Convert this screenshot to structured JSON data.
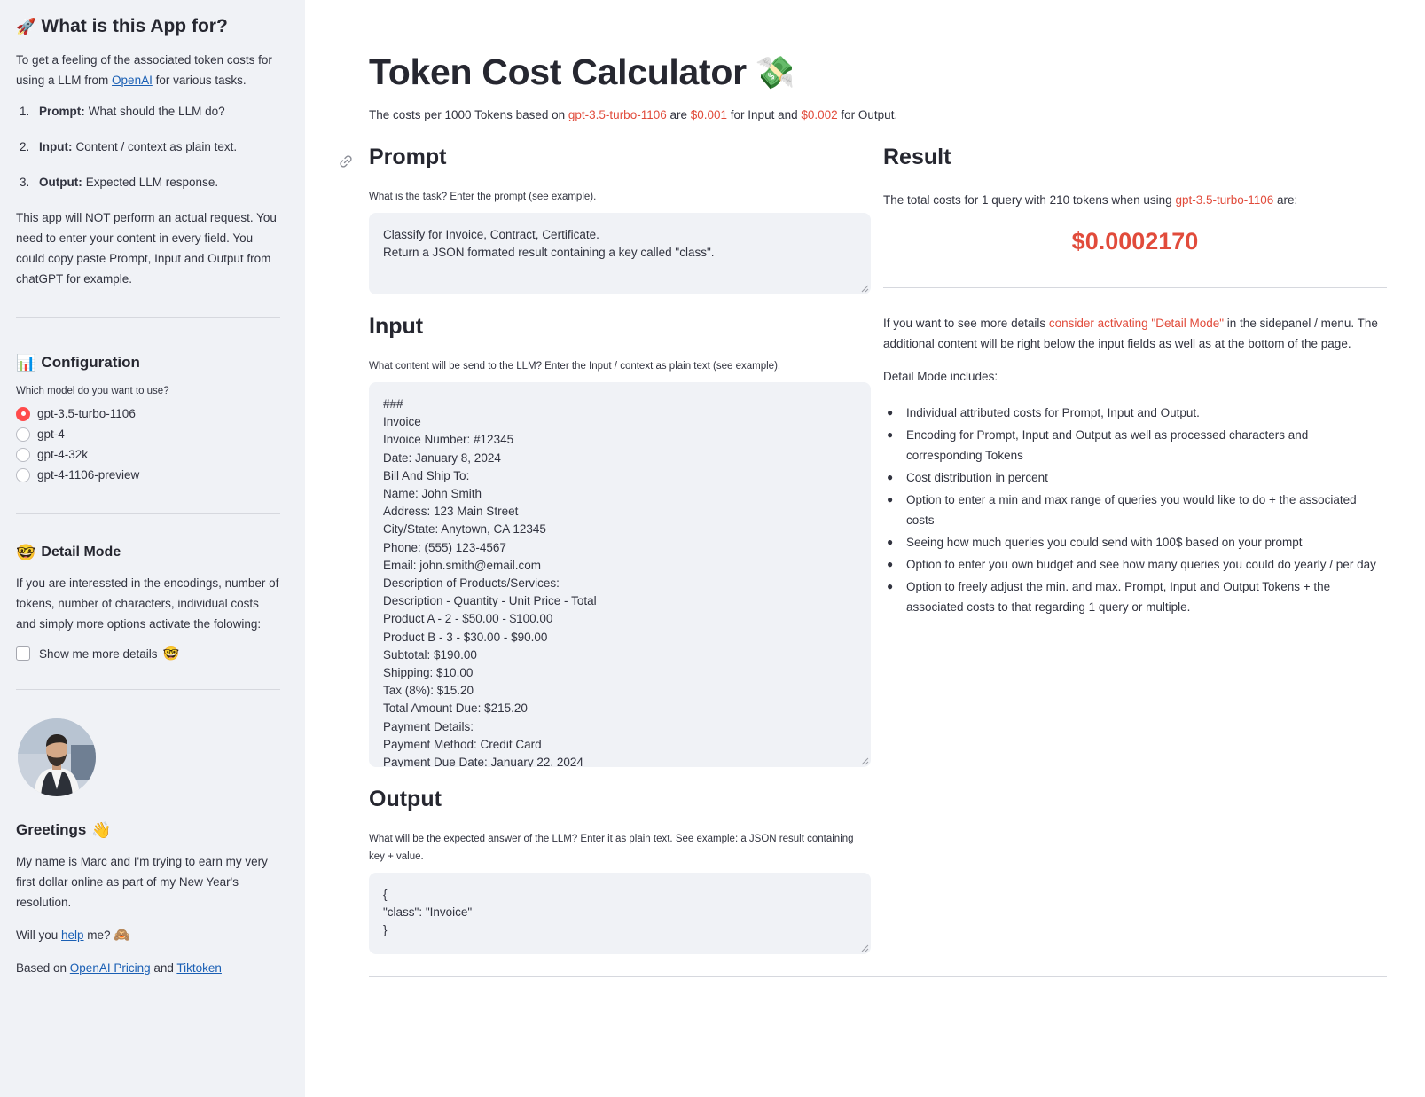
{
  "sidebar": {
    "about": {
      "heading": "What is this App for?",
      "intro_pre": "To get a feeling of the associated token costs for using a LLM from ",
      "intro_link": "OpenAI",
      "intro_post": " for various tasks.",
      "steps": [
        {
          "num": "1.",
          "label": "Prompt:",
          "text": "What should the LLM do?"
        },
        {
          "num": "2.",
          "label": "Input:",
          "text": "Content / context as plain text."
        },
        {
          "num": "3.",
          "label": "Output:",
          "text": "Expected LLM response."
        }
      ],
      "note": "This app will NOT perform an actual request. You need to enter your content in every field. You could copy paste Prompt, Input and Output from chatGPT for example."
    },
    "config": {
      "heading": "Configuration",
      "question": "Which model do you want to use?",
      "models": [
        "gpt-3.5-turbo-1106",
        "gpt-4",
        "gpt-4-32k",
        "gpt-4-1106-preview"
      ],
      "selected": "gpt-3.5-turbo-1106"
    },
    "detail": {
      "heading": "Detail Mode",
      "text": "If you are interessted in the encodings, number of tokens, number of characters, individual costs and simply more options activate the folowing:",
      "checkbox_label": "Show me more details",
      "checked": false
    },
    "greetings": {
      "heading": "Greetings",
      "text": "My name is Marc and I'm trying to earn my very first dollar online as part of my New Year's resolution.",
      "help_pre": "Will you ",
      "help_link": "help",
      "help_post": " me?",
      "based_pre": "Based on ",
      "based_link1": "OpenAI Pricing",
      "based_mid": " and ",
      "based_link2": "Tiktoken"
    }
  },
  "main": {
    "title": "Token Cost Calculator",
    "subtitle": {
      "pre": "The costs per 1000 Tokens based on ",
      "model": "gpt-3.5-turbo-1106",
      "mid1": " are ",
      "input_price": "$0.001",
      "mid2": " for Input and ",
      "output_price": "$0.002",
      "post": " for Output."
    },
    "prompt": {
      "heading": "Prompt",
      "caption": "What is the task? Enter the prompt (see example).",
      "lines": [
        "Classify for Invoice, Contract, Certificate.",
        "Return a JSON formated result containing a key called \"class\"."
      ]
    },
    "input": {
      "heading": "Input",
      "caption": "What content will be send to the LLM? Enter the Input / context as plain text (see example).",
      "lines": [
        "###",
        "Invoice",
        "Invoice Number: #12345",
        "Date: January 8, 2024",
        "Bill And Ship To:",
        "Name: John Smith",
        "Address: 123 Main Street",
        "City/State: Anytown, CA 12345",
        "Phone: (555) 123-4567",
        "Email: john.smith@email.com",
        "Description of Products/Services:",
        "Description - Quantity - Unit Price - Total",
        "Product A - 2 - $50.00 - $100.00",
        "Product B - 3 - $30.00 - $90.00",
        "Subtotal: $190.00",
        "Shipping: $10.00",
        "Tax (8%): $15.20",
        "Total Amount Due: $215.20",
        "Payment Details:",
        "Payment Method: Credit Card",
        "Payment Due Date: January 22, 2024"
      ]
    },
    "output": {
      "heading": "Output",
      "caption": "What will be the expected answer of the LLM? Enter it as plain text. See example: a JSON result containing key + value.",
      "lines": [
        "{",
        "\"class\": \"Invoice\"",
        "}"
      ]
    },
    "result": {
      "heading": "Result",
      "text_pre": "The total costs for 1 query with 210 tokens when using ",
      "model": "gpt-3.5-turbo-1106",
      "text_post": " are:",
      "cost": "$0.0002170",
      "detail_pre": "If you want to see more details ",
      "detail_hint": "consider activating \"Detail Mode\"",
      "detail_post": " in the sidepanel / menu. The additional content will be right below the input fields as well as at the bottom of the page.",
      "includes_label": "Detail Mode includes:",
      "features": [
        "Individual attributed costs for Prompt, Input and Output.",
        "Encoding for Prompt, Input and Output as well as processed characters and corresponding Tokens",
        "Cost distribution in percent",
        "Option to enter a min and max range of queries you would like to do + the associated costs",
        "Seeing how much queries you could send with 100$ based on your prompt",
        "Option to enter you own budget and see how many queries you could do yearly / per day",
        "Option to freely adjust the min. and max. Prompt, Input and Output Tokens + the associated costs to that regarding 1 query or multiple."
      ]
    }
  },
  "colors": {
    "accent_red": "#e14b3b",
    "radio_red": "#ff4b4b",
    "sidebar_bg": "#f0f2f6",
    "link_blue": "#1a5fb4"
  },
  "icons": [
    "rocket-icon",
    "chart-icon",
    "nerd-face-icon",
    "avatar-photo",
    "waving-hand-icon",
    "monkey-icon",
    "money-wings-icon",
    "link-icon"
  ]
}
